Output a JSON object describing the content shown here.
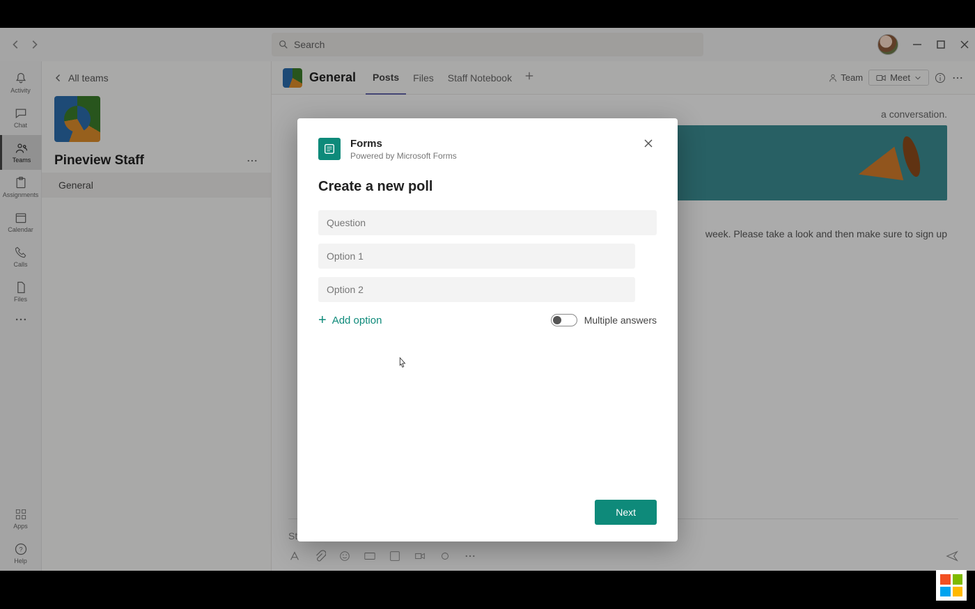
{
  "titlebar": {
    "search_placeholder": "Search"
  },
  "rail": {
    "items": [
      {
        "label": "Activity"
      },
      {
        "label": "Chat"
      },
      {
        "label": "Teams"
      },
      {
        "label": "Assignments"
      },
      {
        "label": "Calendar"
      },
      {
        "label": "Calls"
      },
      {
        "label": "Files"
      }
    ],
    "apps_label": "Apps",
    "help_label": "Help"
  },
  "team_panel": {
    "back_label": "All teams",
    "team_name": "Pineview Staff",
    "channels": [
      {
        "name": "General"
      }
    ]
  },
  "channel_header": {
    "title": "General",
    "tabs": [
      {
        "label": "Posts"
      },
      {
        "label": "Files"
      },
      {
        "label": "Staff Notebook"
      }
    ],
    "team_btn": "Team",
    "meet_btn": "Meet"
  },
  "feed": {
    "line1_suffix": "a conversation.",
    "line2_suffix": "week.  Please take a look and then make sure to sign up"
  },
  "composer": {
    "placeholder": "Start a new conversation. Type @ to mention someone."
  },
  "modal": {
    "app_name": "Forms",
    "subtitle": "Powered by Microsoft Forms",
    "heading": "Create a new poll",
    "question_placeholder": "Question",
    "options": [
      {
        "placeholder": "Option 1"
      },
      {
        "placeholder": "Option 2"
      }
    ],
    "add_option_label": "Add option",
    "multiple_answers_label": "Multiple answers",
    "next_label": "Next"
  }
}
